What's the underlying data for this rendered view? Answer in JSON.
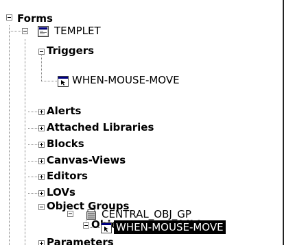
{
  "tree": {
    "nodes": [
      {
        "label": "Forms"
      },
      {
        "label": "TEMPLET"
      },
      {
        "label": "Triggers"
      },
      {
        "label": "WHEN-MOUSE-MOVE"
      },
      {
        "label": "Alerts"
      },
      {
        "label": "Attached Libraries"
      },
      {
        "label": "Blocks"
      },
      {
        "label": "Canvas-Views"
      },
      {
        "label": "Editors"
      },
      {
        "label": "LOVs"
      },
      {
        "label": "Object Groups"
      },
      {
        "label": "CENTRAL_OBJ_GP"
      },
      {
        "label": "Object Group Children"
      },
      {
        "label": "WHEN-MOUSE-MOVE"
      },
      {
        "label": "Parameters"
      }
    ],
    "icons": {
      "form_module": "form-module-icon",
      "trigger": "trigger-icon",
      "object_group": "object-group-icon"
    }
  }
}
